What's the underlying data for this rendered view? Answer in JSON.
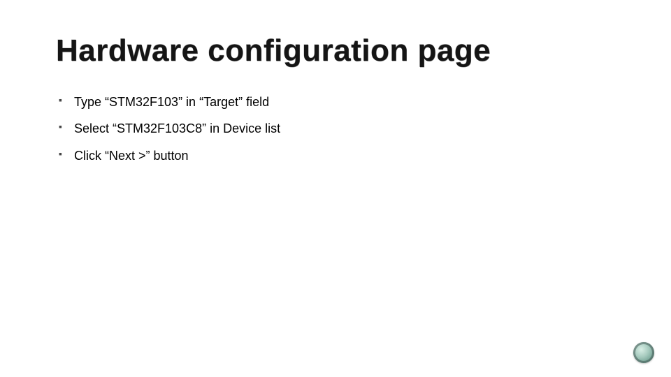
{
  "title": "Hardware configuration page",
  "bullets": [
    "Type “STM32F103” in “Target” field",
    "Select “STM32F103C8” in Device list",
    "Click “Next >” button"
  ]
}
